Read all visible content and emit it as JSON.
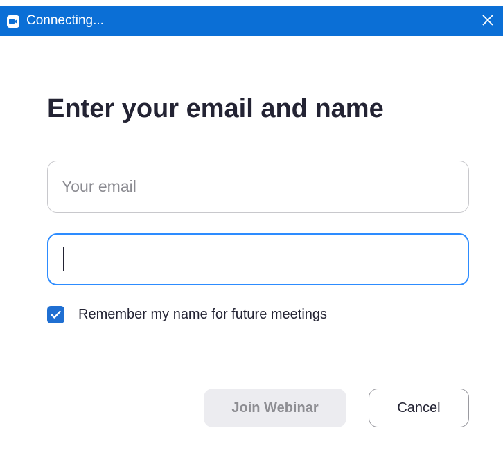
{
  "window": {
    "title": "Connecting...",
    "app_icon": "zoom-camera-icon",
    "close_icon": "close-icon",
    "titlebar_color": "#0b6fd6"
  },
  "form": {
    "heading": "Enter your email and name",
    "email": {
      "placeholder": "Your email",
      "value": ""
    },
    "name": {
      "placeholder": "",
      "value": "",
      "focused": true
    },
    "remember": {
      "label": "Remember my name for future meetings",
      "checked": true
    },
    "join_button": "Join Webinar",
    "cancel_button": "Cancel",
    "accent_color": "#2d8cff"
  }
}
